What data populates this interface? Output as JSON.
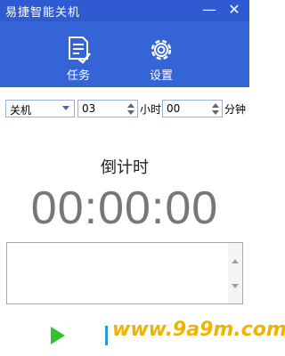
{
  "window": {
    "title": "易捷智能关机",
    "minimize_glyph": "—",
    "close_glyph": "✕"
  },
  "toolbar": {
    "task": {
      "label": "任务",
      "icon": "task-list-icon"
    },
    "settings": {
      "label": "设置",
      "icon": "gear-icon"
    }
  },
  "controls": {
    "action_select": {
      "value": "关机"
    },
    "hours": {
      "value": "03",
      "unit": "小时"
    },
    "minutes": {
      "value": "00",
      "unit": "分钟"
    }
  },
  "countdown": {
    "label": "倒计时",
    "time": "00:00:00"
  },
  "watermark": "www.9a9m.com",
  "colors": {
    "title_bar": "#2f5ad1",
    "header": "#3564d6",
    "play": "#2fc42f",
    "watermark": "#f0b400"
  }
}
